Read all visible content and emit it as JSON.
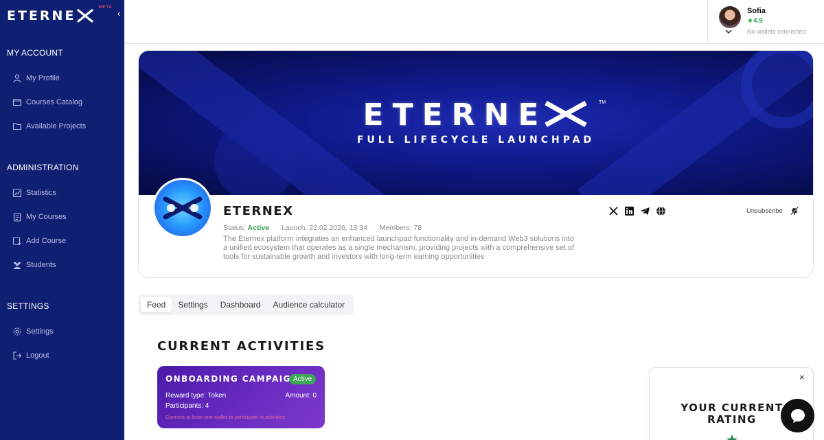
{
  "brand": {
    "name": "ETERNE",
    "beta": "BETA"
  },
  "sidebar": {
    "sections": [
      {
        "title": "MY ACCOUNT",
        "items": [
          {
            "label": "My Profile",
            "icon": "user-icon"
          },
          {
            "label": "Courses Catalog",
            "icon": "catalog-icon"
          },
          {
            "label": "Available Projects",
            "icon": "folder-icon"
          }
        ]
      },
      {
        "title": "ADMINISTRATION",
        "items": [
          {
            "label": "Statistics",
            "icon": "chart-icon"
          },
          {
            "label": "My Courses",
            "icon": "clipboard-icon"
          },
          {
            "label": "Add Course",
            "icon": "add-course-icon"
          },
          {
            "label": "Students",
            "icon": "students-icon"
          }
        ]
      },
      {
        "title": "SETTINGS",
        "items": [
          {
            "label": "Settings",
            "icon": "gear-icon"
          },
          {
            "label": "Logout",
            "icon": "logout-icon"
          }
        ]
      }
    ]
  },
  "user": {
    "name": "Sofia",
    "rating": "★4.9",
    "wallets": "No wallets connected"
  },
  "banner": {
    "title": "ETERNE",
    "subtitle": "FULL LIFECYCLE LAUNCHPAD",
    "tm": "TM"
  },
  "project": {
    "name": "ETERNEX",
    "status_label": "Status:",
    "status_value": "Active",
    "launch": "Launch: 22.02.2026, 13:34",
    "members": "Members: 78",
    "description": "The Eternex platform integrates an enhanced launchpad functionality and in-demand Web3 solutions into a unified ecosystem that operates as a single mechanism, providing projects with a comprehensive set of tools for sustainable growth and investors with long-term earning opportunities",
    "unsubscribe": "Unsubscribe",
    "socials": [
      "x-icon",
      "linkedin-icon",
      "telegram-icon",
      "globe-icon"
    ]
  },
  "tabs": [
    {
      "label": "Feed",
      "active": true
    },
    {
      "label": "Settings",
      "active": false
    },
    {
      "label": "Dashboard",
      "active": false
    },
    {
      "label": "Audience calculator",
      "active": false
    }
  ],
  "activities": {
    "title": "CURRENT ACTIVITIES",
    "card": {
      "title": "ONBOARDING CAMPAIGN",
      "badge": "Active",
      "reward": "Reward type: Token",
      "amount": "Amount: 0",
      "participants": "Participants: 4",
      "warning": "Connect at least one wallet to participate in activities"
    }
  },
  "rating_popup": {
    "title_line1": "YOUR CURRENT",
    "title_line2": "RATING",
    "close": "×"
  },
  "colors": {
    "sidebar": "#0f1f72",
    "accent_green": "#3aa757",
    "card_purple": "#5a24b5"
  }
}
